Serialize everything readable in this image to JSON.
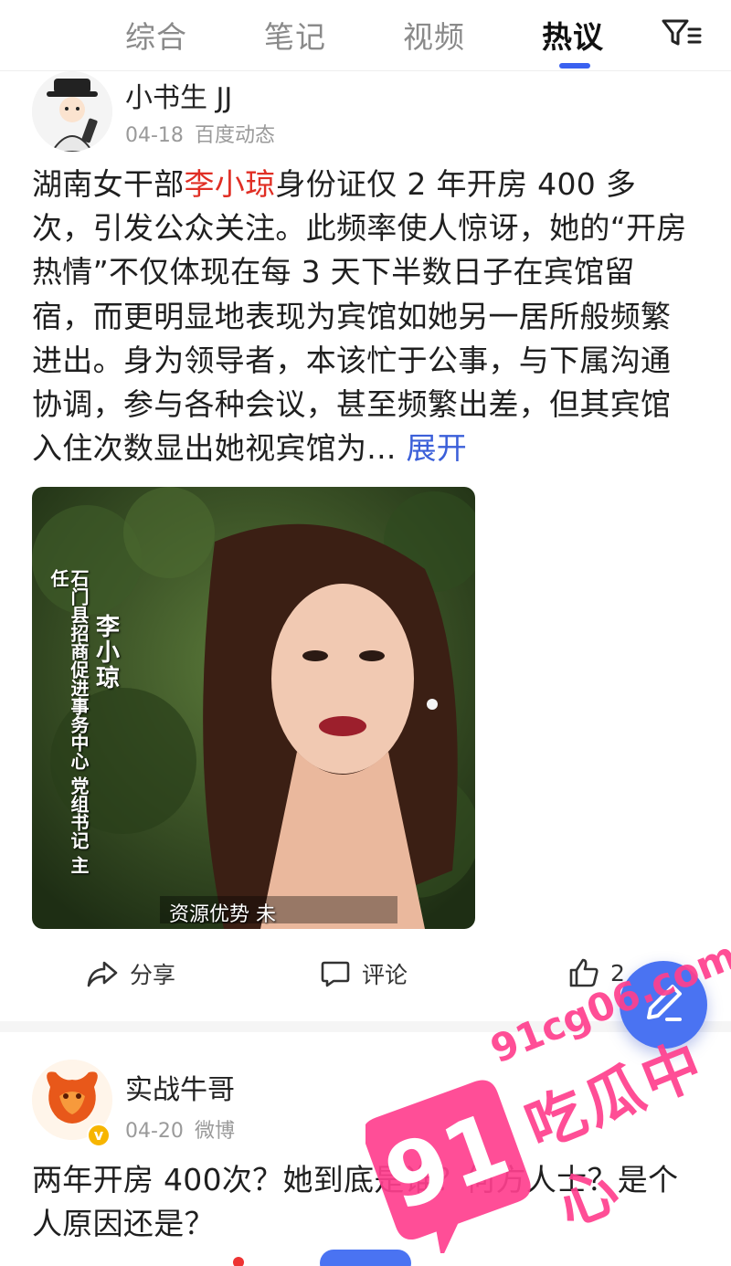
{
  "tabs": [
    "综合",
    "笔记",
    "视频",
    "热议"
  ],
  "active_tab": "热议",
  "posts": [
    {
      "author": "小书生 JJ",
      "date": "04-18",
      "source": "百度动态",
      "text_before": "湖南女干部",
      "text_highlight": "李小琼",
      "text_after": "身份证仅 2 年开房 400 多次，引发公众关注。此频率使人惊讶，她的“开房热情”不仅体现在每 3 天下半数日子在宾馆留宿，而更明显地表现为宾馆如她另一居所般频繁进出。身为领导者，本该忙于公事，与下属沟通协调，参与各种会议，甚至频繁出差，但其宾馆入住次数显出她视宾馆为... ",
      "expand_label": "展开",
      "image_caption_name": "李小琼",
      "image_caption_title": "石门县招商促进事务中心 党组书记 主任",
      "image_subtitle": "资源优势 未",
      "actions": {
        "share": "分享",
        "comment": "评论",
        "like": "2"
      }
    },
    {
      "author": "实战牛哥",
      "date": "04-20",
      "source": "微博",
      "text": "两年开房 400次？她到底是谁？何方人士？是个人原因还是？"
    }
  ],
  "watermark": {
    "url": "91cg06.com",
    "brand": "吃瓜中心",
    "number": "91"
  },
  "colors": {
    "accent": "#3a61f0",
    "highlight": "#e02e24",
    "link": "#3b5fd9",
    "watermark": "#ff3f8e"
  }
}
